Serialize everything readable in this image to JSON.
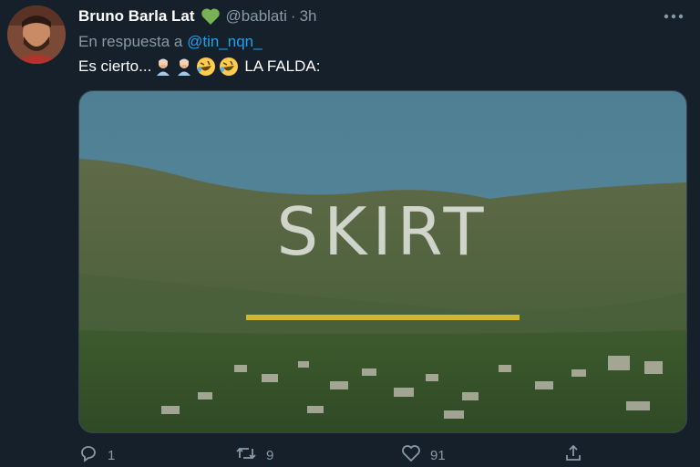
{
  "tweet": {
    "author_name": "Bruno Barla Lat",
    "handle": "@bablati",
    "separator": "·",
    "time": "3h",
    "reply_prefix": "En respuesta a",
    "reply_to": "@tin_nqn_",
    "text_start": "Es cierto...",
    "text_end": "LA FALDA:",
    "emojis": [
      "person-facepalming",
      "person-facepalming",
      "rolling-on-floor-laughing",
      "rolling-on-floor-laughing"
    ],
    "verified_emoji": "green-heart"
  },
  "media": {
    "overlay_text": "SKIRT",
    "accent_bar_color": "#cfb733"
  },
  "actions": {
    "reply_count": "1",
    "retweet_count": "9",
    "like_count": "91"
  },
  "colors": {
    "background": "#15202b",
    "secondary_text": "#8899a6",
    "link": "#1da1f2",
    "heart": "#77b255"
  }
}
